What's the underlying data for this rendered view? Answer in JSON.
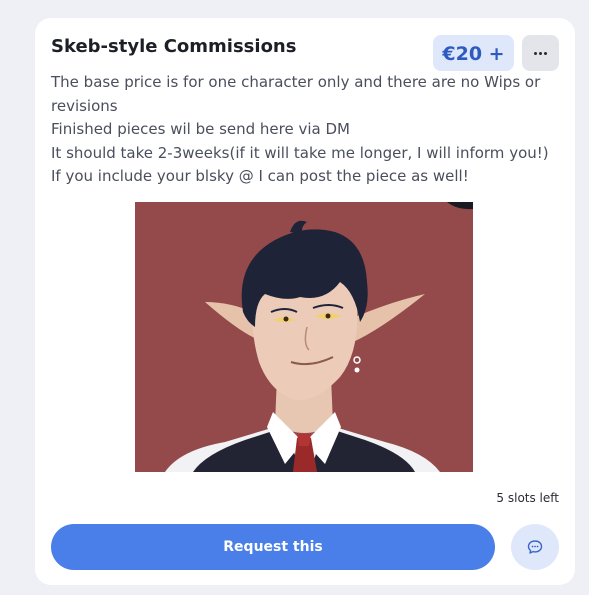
{
  "listing": {
    "title": "Skeb-style Commissions",
    "price": "€20 +",
    "description": [
      "The base price is for one character only and there are no Wips or revisions",
      "Finished pieces wil be send here via DM",
      "It should take 2-3weeks(if it will take me longer, I will inform you!)",
      "If you include your blsky @ I can post the piece as well!"
    ],
    "slots": "5 slots left",
    "request_label": "Request this",
    "more_icon": "more-horizontal-icon",
    "chat_icon": "chat-bubble-icon"
  },
  "colors": {
    "accent": "#4a7ee8",
    "price_text": "#2e5bbf",
    "price_bg": "#dfe7fb",
    "art_background": "#944a4a"
  }
}
